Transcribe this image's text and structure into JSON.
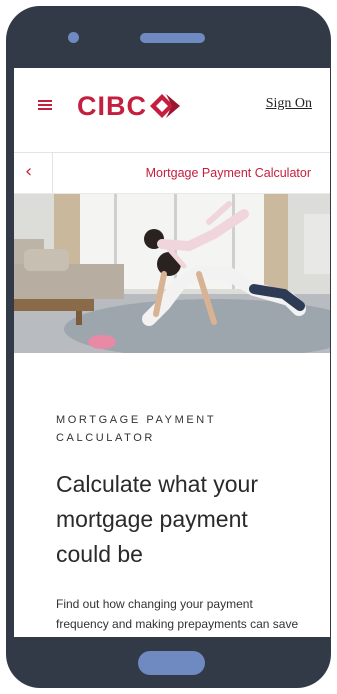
{
  "header": {
    "brand": "CIBC",
    "sign_on": "Sign On"
  },
  "subnav": {
    "title": "Mortgage Payment Calculator"
  },
  "hero": {
    "image": "parent doing push-up with child on back in living room"
  },
  "content": {
    "eyebrow": "MORTGAGE PAYMENT CALCULATOR",
    "headline": "Calculate what your mortgage payment could be",
    "body": "Find out how changing your payment frequency and making prepayments can save you money."
  },
  "colors": {
    "brand_red": "#c41f3e",
    "device_frame": "#333a47",
    "device_accent": "#6f8ac0"
  },
  "icons": [
    "menu-icon",
    "back-chevron-icon",
    "cibc-logo-icon"
  ]
}
